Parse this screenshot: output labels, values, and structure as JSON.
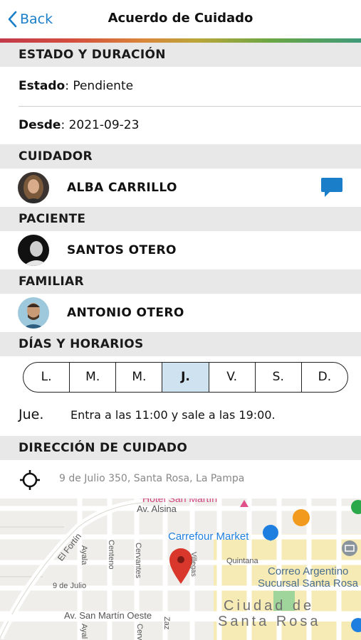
{
  "nav": {
    "back_label": "Back",
    "title": "Acuerdo de Cuidado"
  },
  "sections": {
    "estado": "ESTADO Y DURACIÓN",
    "cuidador": "CUIDADOR",
    "paciente": "PACIENTE",
    "familiar": "FAMILIAR",
    "dias": "DÍAS Y HORARIOS",
    "direccion": "DIRECCIÓN DE CUIDADO"
  },
  "estado": {
    "label": "Estado",
    "value": ": Pendiente"
  },
  "desde": {
    "label": "Desde",
    "value": ": 2021-09-23"
  },
  "cuidador": {
    "name": "ALBA CARRILLO",
    "icon": "chat-bubble-icon"
  },
  "paciente": {
    "name": "SANTOS OTERO"
  },
  "familiar": {
    "name": "ANTONIO OTERO"
  },
  "days": [
    "L.",
    "M.",
    "M.",
    "J.",
    "V.",
    "S.",
    "D."
  ],
  "selected_day": "J.",
  "schedule": {
    "day": "Jue.",
    "text": "Entra a las 11:00 y sale a las 19:00."
  },
  "address": "9 de Julio 350, Santa Rosa, La Pampa",
  "map": {
    "labels": {
      "hotel": "Hotel San Martín",
      "alsina": "Av. Alsina",
      "carrefour": "Carrefour Market",
      "el_fortin": "El Fortín",
      "ayala": "Ayala",
      "centeno": "Centeno",
      "cervantes": "Cervantes",
      "villegas": "Villegas",
      "quintana": "Quintana",
      "correo1": "Correo Argentino",
      "correo2": "Sucursal Santa Rosa",
      "nueve_julio": "9 de Julio",
      "san_martin": "Av. San Martín Oeste",
      "ciudad1": "Ciudad de",
      "ciudad2": "Santa Rosa",
      "cerv2": "Cerv",
      "ayal2": "Ayal",
      "zaz": "Zaz"
    },
    "colors": {
      "pin": "#d9372b",
      "carrefour": "#1e7fe0",
      "accent": "#1a7fc8"
    }
  }
}
